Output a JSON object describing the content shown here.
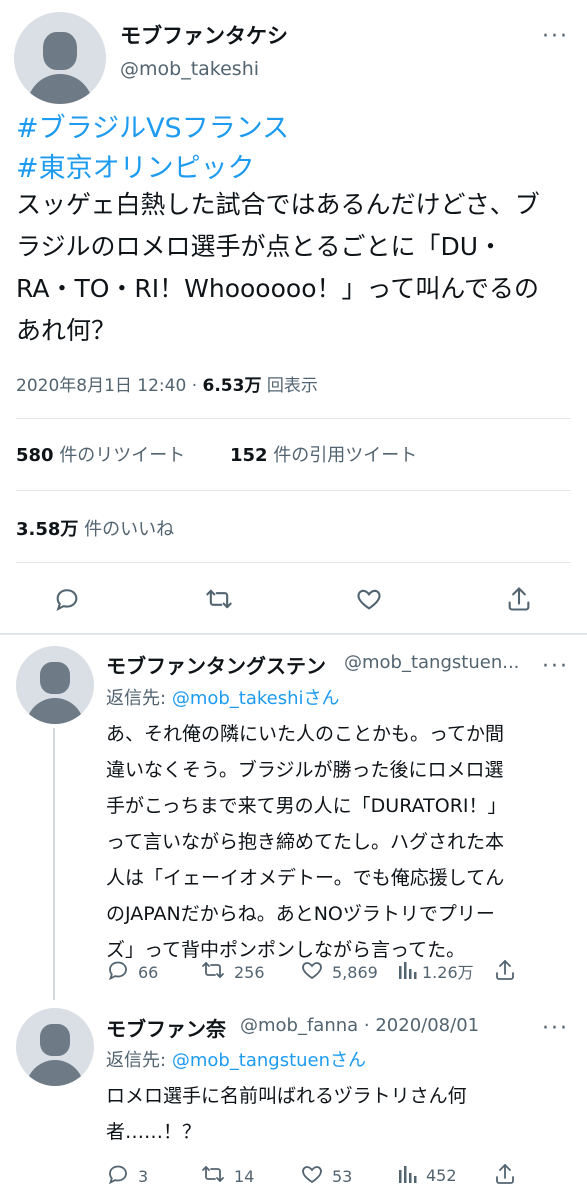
{
  "main_tweet": {
    "name": "モブファンタケシ",
    "handle": "@mob_takeshi",
    "hashtags": [
      "#ブラジルVSフランス",
      "#東京オリンピック"
    ],
    "text_lines": [
      "スッゲェ白熱した試合ではあるんだけどさ、ブ",
      "ラジルのロメロ選手が点とるごとに「DU・",
      "RA・TO・RI！Whoooooo！」って叫んでるの",
      "あれ何？"
    ],
    "timestamp": "2020年8月1日 12:40",
    "separator": "·",
    "views": "6.53万",
    "views_label": "回表示",
    "retweets_count": "580",
    "retweets_label": "件のリツイート",
    "quotes_count": "152",
    "quotes_label": "件の引用ツイート",
    "likes_count": "3.58万",
    "likes_label": "件のいいね"
  },
  "replies": [
    {
      "name": "モブファンタングステン",
      "handle": "@mob_tangstuen...",
      "replying_label": "返信先:",
      "replying_to": "@mob_takeshi",
      "replying_suffix": "さん",
      "text_lines": [
        "あ、それ俺の隣にいた人のことかも。ってか間",
        "違いなくそう。ブラジルが勝った後にロメロ選",
        "手がこっちまで来て男の人に「DURATORI！」",
        "って言いながら抱き締めてたし。ハグされた本",
        "人は「イェーイオメデトー。でも俺応援してん",
        "のJAPANだからね。あとNOヅラトリでプリー",
        "ズ」って背中ポンポンしながら言ってた。"
      ],
      "replies": "66",
      "retweets": "256",
      "likes": "5,869",
      "views": "1.26万"
    },
    {
      "name": "モブファン奈",
      "handle": "@mob_fanna · 2020/08/01",
      "replying_label": "返信先:",
      "replying_to": "@mob_tangstuen",
      "replying_suffix": "さん",
      "text_lines": [
        "ロメロ選手に名前叫ばれるヅラトリさん何",
        "者……！？"
      ],
      "replies": "3",
      "retweets": "14",
      "likes": "53",
      "views": "452"
    }
  ],
  "more_label": "···",
  "icons": [
    "reply-icon",
    "retweet-icon",
    "like-icon",
    "share-icon",
    "views-icon",
    "more-icon"
  ],
  "colors": {
    "link": "#1d9bf0",
    "muted": "#536471",
    "text": "#0f1419",
    "divider": "#e1e6ea"
  }
}
